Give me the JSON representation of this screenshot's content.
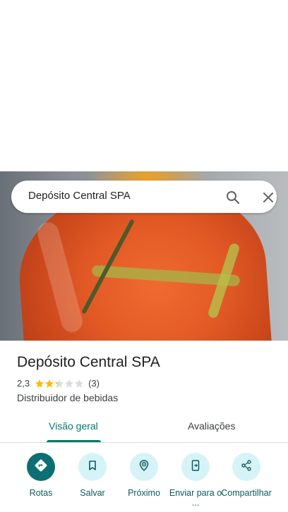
{
  "search": {
    "query": "Depósito Central SPA"
  },
  "place": {
    "name": "Depósito Central SPA",
    "rating": "2,3",
    "rating_value": 2.3,
    "rating_max": 5,
    "review_count": "(3)",
    "category": "Distribuidor de bebidas"
  },
  "tabs": [
    {
      "label": "Visão geral",
      "active": true
    },
    {
      "label": "Avaliações",
      "active": false
    }
  ],
  "actions": [
    {
      "label": "Rotas",
      "icon": "directions-icon"
    },
    {
      "label": "Salvar",
      "icon": "bookmark-icon"
    },
    {
      "label": "Próximo",
      "icon": "nearby-icon"
    },
    {
      "label": "Enviar para o ...",
      "icon": "send-to-phone-icon"
    },
    {
      "label": "Compartilhar",
      "icon": "share-icon"
    }
  ],
  "colors": {
    "accent": "#00796b",
    "star": "#fbbc04",
    "star_empty": "#dadce0",
    "action_primary": "#0b6f73",
    "action_bg": "#d6f4f8"
  }
}
